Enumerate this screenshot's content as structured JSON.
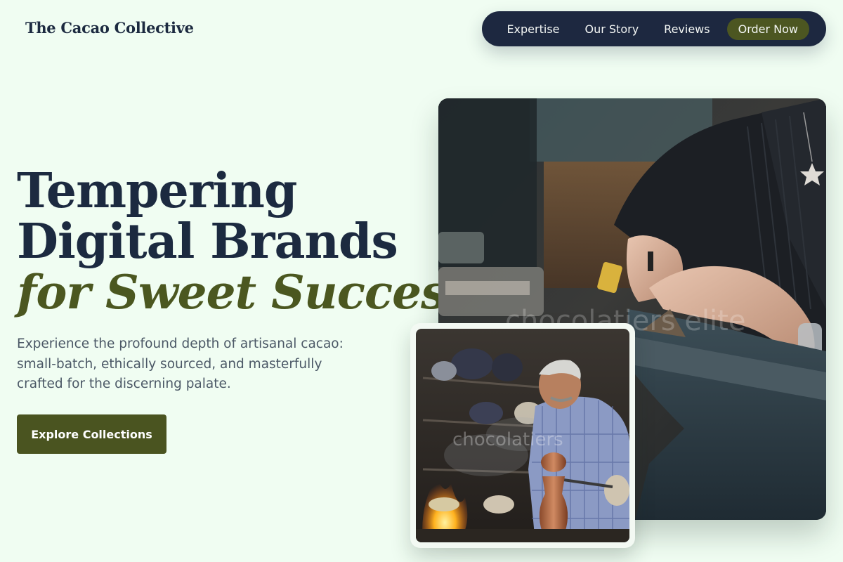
{
  "brand": {
    "name": "The Cacao Collective"
  },
  "nav": {
    "items": [
      {
        "label": "Expertise"
      },
      {
        "label": "Our Story"
      },
      {
        "label": "Reviews"
      }
    ],
    "order_label": "Order Now"
  },
  "hero": {
    "title_line1": "Tempering",
    "title_line2": "Digital Brands",
    "title_accent": "for Sweet Success",
    "description": "Experience the profound depth of artisanal cacao: small-batch, ethically sourced, and masterfully crafted for the discerning palate.",
    "cta_label": "Explore Collections"
  },
  "images": {
    "main_watermark": "chocolatiers elite",
    "small_watermark": "chocolatiers"
  },
  "colors": {
    "background": "#f0fdf2",
    "navy": "#1d2840",
    "olive": "#4a5420"
  }
}
